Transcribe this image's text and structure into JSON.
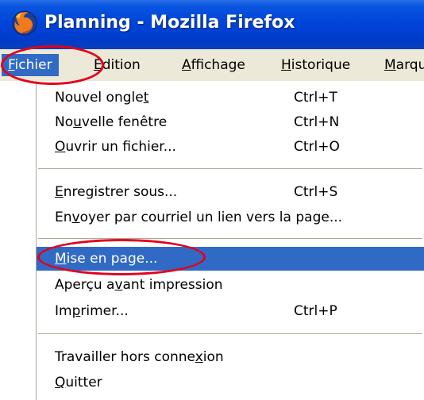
{
  "window": {
    "title": "Planning - Mozilla Firefox",
    "icon": "firefox-icon"
  },
  "menubar": {
    "items": [
      {
        "label_u": "F",
        "label_rest": "ichier",
        "active": true
      },
      {
        "label_u": "É",
        "label_rest": "dition",
        "active": false
      },
      {
        "label_u": "A",
        "label_rest": "ffichage",
        "active": false
      },
      {
        "label_u": "H",
        "label_rest": "istorique",
        "active": false
      },
      {
        "label_u": "M",
        "label_rest": "arqu",
        "active": false
      }
    ]
  },
  "file_menu": {
    "groups": [
      [
        {
          "pre": "Nouvel ongle",
          "u": "t",
          "post": "",
          "shortcut": "Ctrl+T"
        },
        {
          "pre": "No",
          "u": "u",
          "post": "velle fenêtre",
          "shortcut": "Ctrl+N"
        },
        {
          "pre": "",
          "u": "O",
          "post": "uvrir un fichier...",
          "shortcut": "Ctrl+O"
        }
      ],
      [
        {
          "pre": "",
          "u": "E",
          "post": "nregistrer sous...",
          "shortcut": "Ctrl+S"
        },
        {
          "pre": "En",
          "u": "v",
          "post": "oyer par courriel un lien vers la page...",
          "shortcut": ""
        }
      ],
      [
        {
          "pre": "",
          "u": "M",
          "post": "ise en page...",
          "shortcut": "",
          "highlighted": true
        },
        {
          "pre": "Aperçu a",
          "u": "v",
          "post": "ant impression",
          "shortcut": ""
        },
        {
          "pre": "Im",
          "u": "p",
          "post": "rimer...",
          "shortcut": "Ctrl+P"
        }
      ],
      [
        {
          "pre": "Travailler hors conne",
          "u": "x",
          "post": "ion",
          "shortcut": ""
        },
        {
          "pre": "",
          "u": "Q",
          "post": "uitter",
          "shortcut": ""
        }
      ]
    ]
  },
  "colors": {
    "titlebar": "#0044d8",
    "menubar_bg": "#ece9d8",
    "highlight": "#316ac5",
    "annotation": "#e3001b"
  }
}
